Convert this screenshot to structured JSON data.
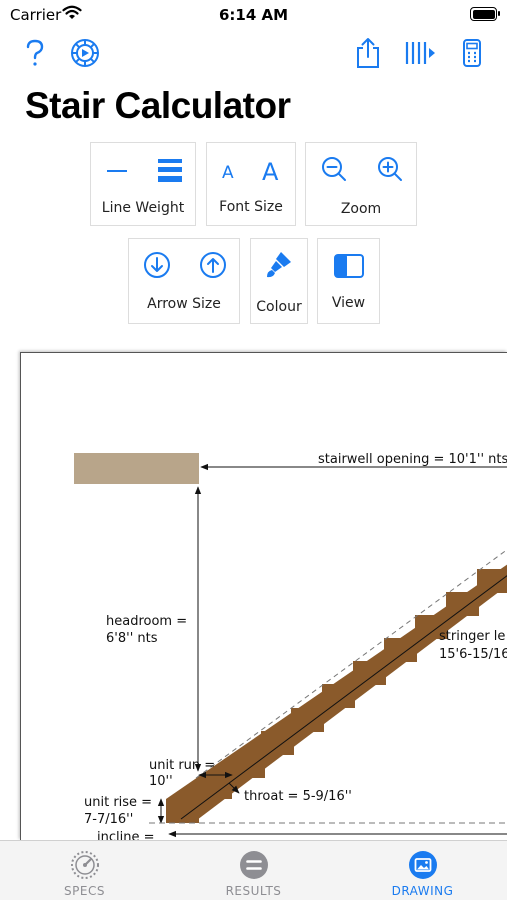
{
  "status_bar": {
    "carrier": "Carrier",
    "time": "6:14 AM"
  },
  "app": {
    "title": "Stair Calculator"
  },
  "nav": {
    "left": [
      "help-icon",
      "settings-icon"
    ],
    "right": [
      "share-icon",
      "animate-steps-icon",
      "calculator-icon"
    ]
  },
  "controls": {
    "line_weight": "Line Weight",
    "font_size": "Font Size",
    "zoom": "Zoom",
    "arrow_size": "Arrow Size",
    "colour": "Colour",
    "view": "View"
  },
  "drawing": {
    "stairwell_opening": "stairwell opening = 10'1'' nts",
    "headroom_line1": "headroom =",
    "headroom_line2": "6'8'' nts",
    "stringer_line1": "stringer le",
    "stringer_line2": "15'6-15/16",
    "unit_run_line1": "unit run =",
    "unit_run_line2": "10''",
    "throat": "throat = 5-9/16''",
    "unit_rise_line1": "unit rise =",
    "unit_rise_line2": "7-7/16''",
    "incline": "incline =",
    "colors": {
      "wood": "#8a5a2b",
      "opening": "#b8a58a",
      "stroke": "#111111"
    }
  },
  "tabs": [
    {
      "label": "SPECS",
      "icon": "gauge-icon",
      "active": false
    },
    {
      "label": "RESULTS",
      "icon": "equals-icon",
      "active": false
    },
    {
      "label": "DRAWING",
      "icon": "image-icon",
      "active": true
    }
  ],
  "accent_color": "#1a7bf0"
}
